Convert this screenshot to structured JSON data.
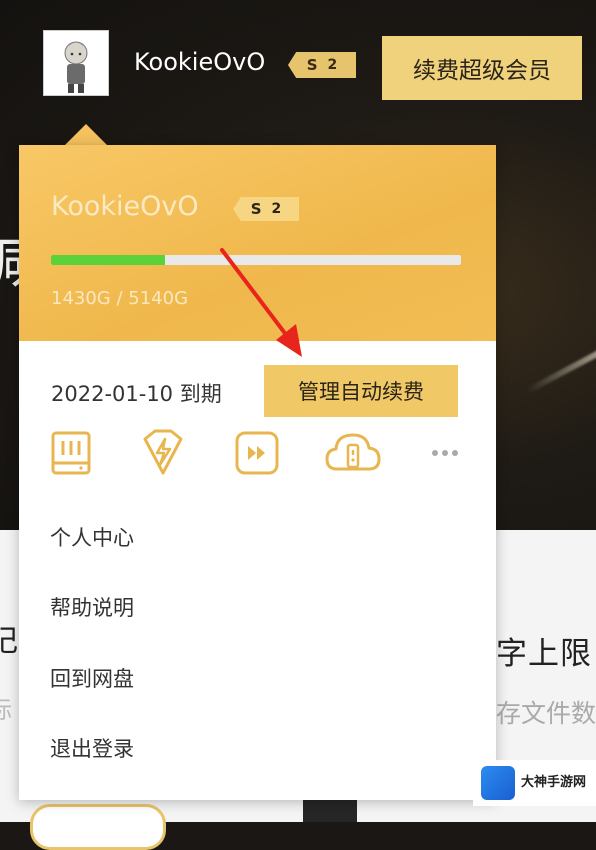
{
  "header": {
    "username": "KookieOvO",
    "badge_letter": "S",
    "badge_level": "2",
    "renew_label": "续费超级会员"
  },
  "dropdown": {
    "username": "KookieOvO",
    "badge_letter": "S",
    "badge_level": "2",
    "storage_text": "1430G / 5140G",
    "storage_used_fraction": 0.278,
    "expire_text": "2022-01-10 到期",
    "manage_label": "管理自动续费",
    "icons": [
      "storage-icon",
      "speedup-icon",
      "play-icon",
      "cloud-lock-icon",
      "more-icon"
    ],
    "menu": [
      "个人中心",
      "帮助说明",
      "回到网盘",
      "退出登录"
    ]
  },
  "background": {
    "heading_fragment": "字上限",
    "sub_fragment": "存文件数",
    "left_char": "減",
    "left_fragment_1": "记",
    "left_fragment_2": "标"
  },
  "watermark": {
    "name": "大神手游网"
  },
  "colors": {
    "gold": "#f0d27c",
    "gold_head": "#f5c25f",
    "progress_green": "#5bd23a",
    "annotation_red": "#e8251c"
  }
}
